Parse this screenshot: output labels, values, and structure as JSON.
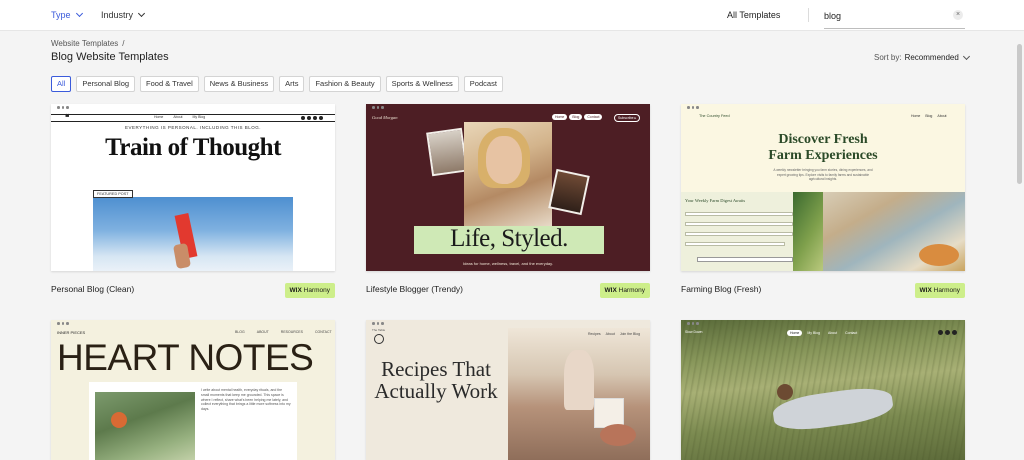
{
  "topbar": {
    "type_label": "Type",
    "industry_label": "Industry",
    "all_templates_label": "All Templates",
    "search_value": "blog",
    "search_clear": "×"
  },
  "breadcrumb": {
    "root": "Website Templates",
    "separator": "/"
  },
  "page_title": "Blog Website Templates",
  "sort": {
    "label": "Sort by:",
    "value": "Recommended"
  },
  "filters": [
    "All",
    "Personal Blog",
    "Food & Travel",
    "News & Business",
    "Arts",
    "Fashion & Beauty",
    "Sports & Wellness",
    "Podcast"
  ],
  "active_filter": "All",
  "badge": {
    "brand": "WIX",
    "text": "Harmony"
  },
  "cards": [
    {
      "title": "Personal Blog (Clean)",
      "preview": {
        "quote": "❝",
        "links": [
          "Home",
          "About",
          "My Blog"
        ],
        "kicker": "EVERYTHING IS PERSONAL. INCLUDING THIS BLOG.",
        "headline": "Train of Thought",
        "tag": "FEATURED POST"
      }
    },
    {
      "title": "Lifestyle Blogger (Trendy)",
      "preview": {
        "brand": "Good Morgan",
        "nav": [
          "Home",
          "Blog",
          "Contact"
        ],
        "subscribe": "Subscribe ▸",
        "headline": "Life, Styled.",
        "tagline": "Ideas for home, wellness, travel, and the everyday."
      }
    },
    {
      "title": "Farming Blog (Fresh)",
      "preview": {
        "brand": "The Country Feed",
        "nav": [
          "Home",
          "Blog",
          "About"
        ],
        "headline_1": "Discover Fresh",
        "headline_2": "Farm Experiences",
        "description": "A weekly newsletter bringing you farm stories, dining experiences, and expert growing tips. Explore visits to family farms and sustainable agricultural insights.",
        "form_title": "Your Weekly Farm Digest Awaits"
      }
    },
    {
      "title": "",
      "preview": {
        "brand": "INNER PIECES",
        "nav": [
          "BLOG",
          "ABOUT",
          "RESOURCES",
          "CONTACT"
        ],
        "headline": "HEART NOTES",
        "text": "I write about mental health, everyday rituals, and the small moments that keep me grounded. This space is where I reflect, share what's been helping me lately, and collect everything that brings a little more softness into my days."
      }
    },
    {
      "title": "",
      "preview": {
        "brand": "The Table",
        "nav": [
          "Recipes",
          "About",
          "Join the Blog"
        ],
        "headline": "Recipes That Actually Work"
      }
    },
    {
      "title": "",
      "preview": {
        "brand": "Slow Down",
        "nav": [
          "Home",
          "My Blog",
          "About",
          "Contact"
        ]
      }
    }
  ]
}
